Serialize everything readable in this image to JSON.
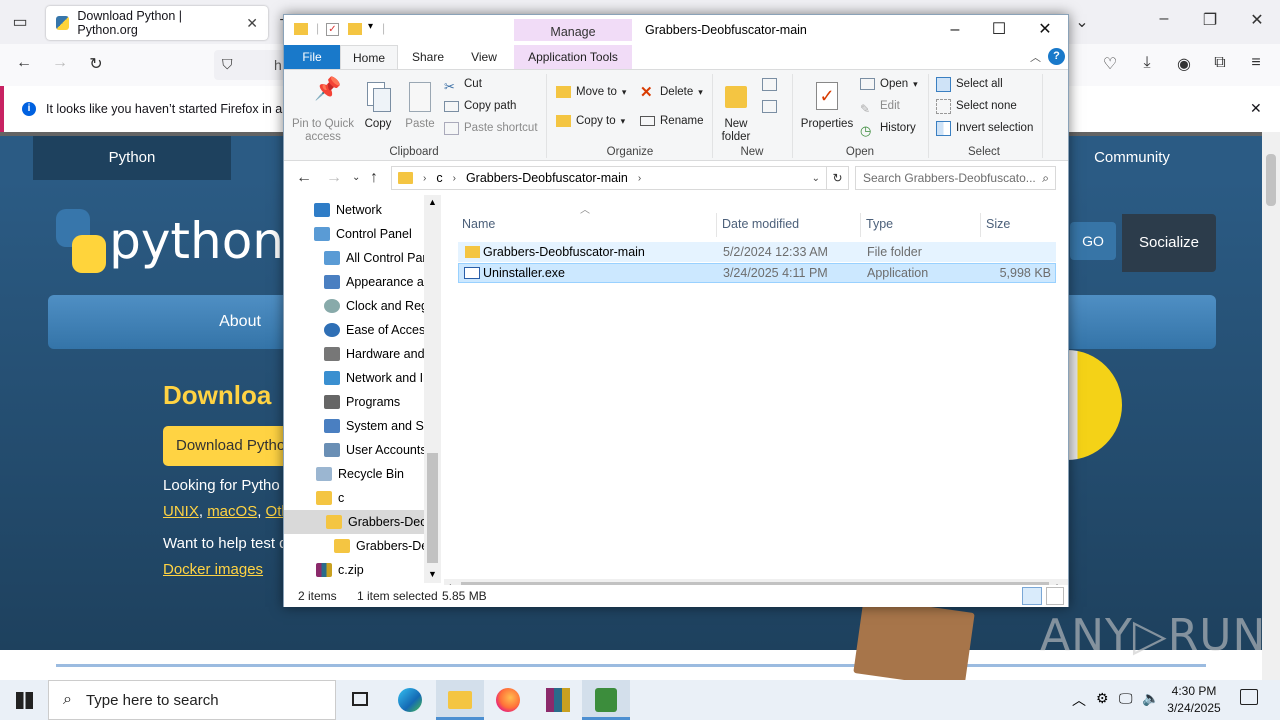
{
  "browser": {
    "tab_title": "Download Python | Python.org",
    "url_partial": "h",
    "notice": "It looks like you haven’t started Firefox in a wh"
  },
  "site": {
    "nav": [
      "Python",
      "Community"
    ],
    "logo_text": "python",
    "menu": [
      "About"
    ],
    "go_label": "GO",
    "socialize_label": "Socialize",
    "heading": "Downloa",
    "download_button": "Download Pytho",
    "looking_for": "Looking for Pytho",
    "os_links": [
      "UNIX",
      "macOS",
      "Othe"
    ],
    "help_text": "Want to help test d",
    "docker_link": "Docker images",
    "watermark": "ANY▷RUN"
  },
  "explorer": {
    "title": "Grabbers-Deobfuscator-main",
    "manage_label": "Manage",
    "ribbon_tabs": [
      "File",
      "Home",
      "Share",
      "View",
      "Application Tools"
    ],
    "clipboard": {
      "pin": "Pin to Quick access",
      "copy": "Copy",
      "paste": "Paste",
      "cut": "Cut",
      "copy_path": "Copy path",
      "paste_shortcut": "Paste shortcut",
      "label": "Clipboard"
    },
    "organize": {
      "move_to": "Move to",
      "copy_to": "Copy to",
      "delete": "Delete",
      "rename": "Rename",
      "label": "Organize"
    },
    "new_group": {
      "new_folder": "New folder",
      "label": "New"
    },
    "open_group": {
      "properties": "Properties",
      "open": "Open",
      "edit": "Edit",
      "history": "History",
      "label": "Open"
    },
    "select_group": {
      "select_all": "Select all",
      "select_none": "Select none",
      "invert": "Invert selection",
      "label": "Select"
    },
    "address": [
      "c",
      "Grabbers-Deobfuscator-main"
    ],
    "search_placeholder": "Search Grabbers-Deobfuscato...",
    "tree": [
      "Network",
      "Control Panel",
      "All Control Par",
      "Appearance an",
      "Clock and Regi",
      "Ease of Access",
      "Hardware and",
      "Network and In",
      "Programs",
      "System and Sec",
      "User Accounts",
      "Recycle Bin",
      "c",
      "Grabbers-Deob",
      "Grabbers-Dec",
      "c.zip"
    ],
    "columns": [
      "Name",
      "Date modified",
      "Type",
      "Size"
    ],
    "files": [
      {
        "name": "Grabbers-Deobfuscator-main",
        "date": "5/2/2024 12:33 AM",
        "type": "File folder",
        "size": ""
      },
      {
        "name": "Uninstaller.exe",
        "date": "3/24/2025 4:11 PM",
        "type": "Application",
        "size": "5,998 KB"
      }
    ],
    "status": {
      "count": "2 items",
      "selected": "1 item selected",
      "size": "5.85 MB"
    }
  },
  "taskbar": {
    "search_placeholder": "Type here to search",
    "time": "4:30 PM",
    "date": "3/24/2025"
  }
}
